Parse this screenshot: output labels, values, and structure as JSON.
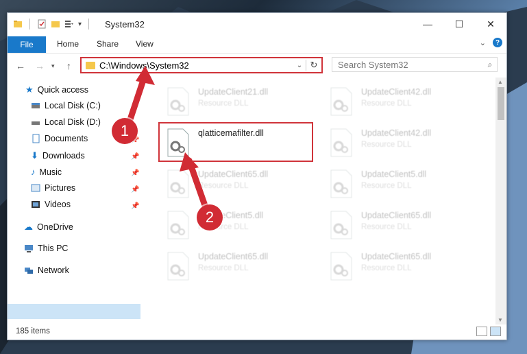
{
  "window": {
    "title": "System32",
    "controls": {
      "minimize": "—",
      "maximize": "☐",
      "close": "✕"
    }
  },
  "ribbon": {
    "tabs": [
      "File",
      "Home",
      "Share",
      "View"
    ]
  },
  "navigation": {
    "address": "C:\\Windows\\System32",
    "search_placeholder": "Search System32"
  },
  "sidebar": {
    "items": [
      {
        "label": "Quick access",
        "icon": "star-icon",
        "pinned": false
      },
      {
        "label": "Local Disk (C:)",
        "icon": "drive-icon",
        "pinned": false
      },
      {
        "label": "Local Disk (D:)",
        "icon": "drive-icon",
        "pinned": false
      },
      {
        "label": "Documents",
        "icon": "documents-icon",
        "pinned": true
      },
      {
        "label": "Downloads",
        "icon": "download-icon",
        "pinned": true
      },
      {
        "label": "Music",
        "icon": "music-icon",
        "pinned": true
      },
      {
        "label": "Pictures",
        "icon": "pictures-icon",
        "pinned": true
      },
      {
        "label": "Videos",
        "icon": "videos-icon",
        "pinned": true
      },
      {
        "label": "OneDrive",
        "icon": "cloud-icon",
        "pinned": false
      },
      {
        "label": "This PC",
        "icon": "computer-icon",
        "pinned": false,
        "selected": true
      },
      {
        "label": "Network",
        "icon": "network-icon",
        "pinned": false
      }
    ]
  },
  "files": [
    {
      "name": "UpdateClient21.dll",
      "type": "Resource DLL",
      "faded": true
    },
    {
      "name": "UpdateClient42.dll",
      "type": "Resource DLL",
      "faded": true
    },
    {
      "name": "qlatticemafilter.dll",
      "type": "",
      "faded": false,
      "highlighted": true
    },
    {
      "name": "UpdateClient42.dll",
      "type": "Resource DLL",
      "faded": true
    },
    {
      "name": "UpdateClient65.dll",
      "type": "Resource DLL",
      "faded": true
    },
    {
      "name": "UpdateClient5.dll",
      "type": "Resource DLL",
      "faded": true
    },
    {
      "name": "UpdateClient5.dll",
      "type": "Resource DLL",
      "faded": true
    },
    {
      "name": "UpdateClient65.dll",
      "type": "Resource DLL",
      "faded": true
    },
    {
      "name": "UpdateClient65.dll",
      "type": "Resource DLL",
      "faded": true
    },
    {
      "name": "UpdateClient65.dll",
      "type": "Resource DLL",
      "faded": true
    }
  ],
  "status": {
    "item_count": "185 items"
  },
  "annotations": {
    "step1": "1",
    "step2": "2"
  },
  "colors": {
    "accent": "#1979ca",
    "highlight": "#d0343a",
    "selection": "#cce4f7"
  }
}
